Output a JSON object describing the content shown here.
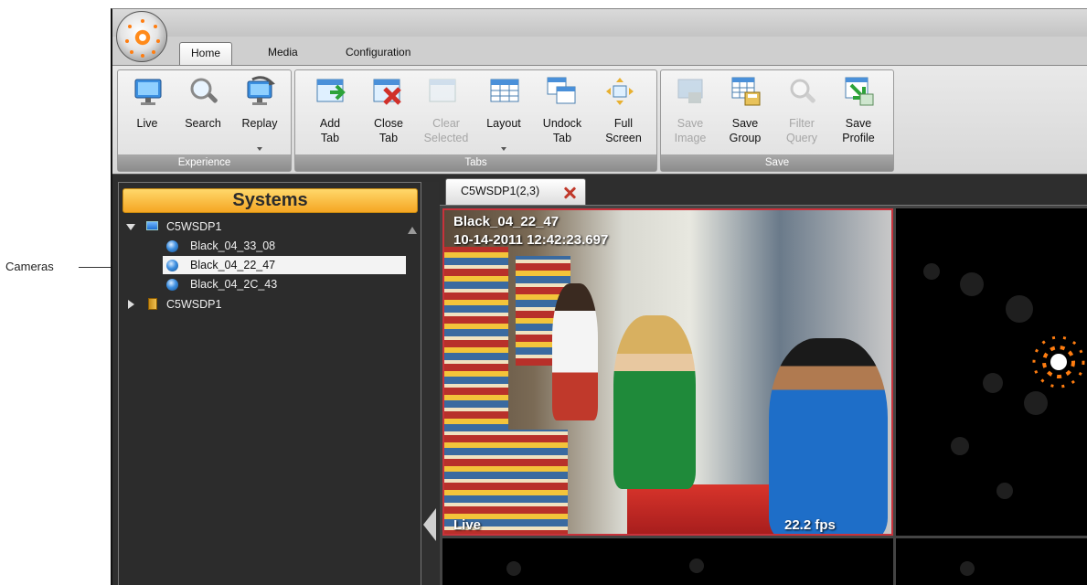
{
  "annotation": {
    "callout_label": "Cameras"
  },
  "ribbon": {
    "tabs": [
      {
        "label": "Home",
        "active": true
      },
      {
        "label": "Media",
        "active": false
      },
      {
        "label": "Configuration",
        "active": false
      }
    ],
    "groups": {
      "experience": {
        "label": "Experience",
        "buttons": [
          {
            "label": "Live",
            "icon": "monitor-icon",
            "enabled": true
          },
          {
            "label": "Search",
            "icon": "magnifier-icon",
            "enabled": true
          },
          {
            "label": "Replay",
            "icon": "replay-icon",
            "enabled": true,
            "has_dropdown": true
          }
        ]
      },
      "tabs": {
        "label": "Tabs",
        "buttons": [
          {
            "label": "Add Tab",
            "icon": "add-tab-icon",
            "enabled": true
          },
          {
            "label": "Close Tab",
            "icon": "close-tab-icon",
            "enabled": true
          },
          {
            "label": "Clear Selected",
            "icon": "clear-selected-icon",
            "enabled": false
          },
          {
            "label": "Layout",
            "icon": "layout-grid-icon",
            "enabled": true,
            "has_dropdown": true
          },
          {
            "label": "Undock Tab",
            "icon": "undock-tab-icon",
            "enabled": true
          },
          {
            "label": "Full Screen",
            "icon": "fullscreen-icon",
            "enabled": true
          }
        ]
      },
      "save": {
        "label": "Save",
        "buttons": [
          {
            "label": "Save Image",
            "icon": "save-image-icon",
            "enabled": false
          },
          {
            "label": "Save Group",
            "icon": "save-group-icon",
            "enabled": true
          },
          {
            "label": "Filter Query",
            "icon": "filter-query-icon",
            "enabled": false
          },
          {
            "label": "Save Profile",
            "icon": "save-profile-icon",
            "enabled": true
          }
        ]
      }
    }
  },
  "systems": {
    "title": "Systems",
    "tree": [
      {
        "label": "C5WSDP1",
        "type": "system",
        "expanded": true
      },
      {
        "label": "Black_04_33_08",
        "type": "camera"
      },
      {
        "label": "Black_04_22_47",
        "type": "camera",
        "selected": true
      },
      {
        "label": "Black_04_2C_43",
        "type": "camera"
      },
      {
        "label": "C5WSDP1",
        "type": "server",
        "expanded": false
      }
    ]
  },
  "view": {
    "tab_label": "C5WSDP1(2,3)",
    "active_cell": {
      "camera_name": "Black_04_22_47",
      "timestamp": "10-14-2011 12:42:23.697",
      "mode": "Live",
      "fps": "22.2 fps"
    }
  },
  "colors": {
    "accent": "#f5a623",
    "selection_border": "#c8323b",
    "brand_orange": "#ff7d10"
  }
}
